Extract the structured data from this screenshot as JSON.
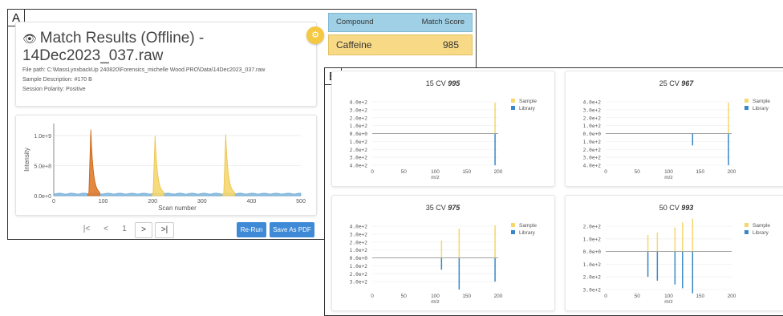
{
  "panel_a_letter": "A",
  "panel_b_letter": "B",
  "header": {
    "title_line1": "Match Results (Offline) -",
    "title_line2": "14Dec2023_037.raw",
    "file_path": "File path: C:\\MassLynxbackUp 240820\\Forensics_michelle Wood.PRO\\Data\\14Dec2023_037.raw",
    "sample_description": "Sample Description: #170 B",
    "session_polarity": "Session Polarity: Positive"
  },
  "icons": {
    "eye": "eye-icon",
    "gear": "gear-icon"
  },
  "colors": {
    "sample": "#f5d76e",
    "library": "#3a87c8",
    "peak_highlight": "#e07b2a",
    "button_blue": "#3f8ad6",
    "table_head": "#9fd0e6",
    "table_row": "#f8da86"
  },
  "chromatogram": {
    "type": "area",
    "ylabel": "Intensity",
    "xlabel": "Scan number",
    "y_ticks": [
      "1.0e+9",
      "5.0e+8",
      "0.0e+0"
    ],
    "x_ticks": [
      "0",
      "100",
      "200",
      "300",
      "400",
      "500"
    ],
    "xlim": [
      0,
      500
    ],
    "ylim": [
      0,
      1200000000
    ],
    "peaks": [
      {
        "apex": 75,
        "height": 1100000000,
        "highlight": true
      },
      {
        "apex": 205,
        "height": 1000000000,
        "highlight": false
      },
      {
        "apex": 348,
        "height": 1020000000,
        "highlight": false
      }
    ],
    "baseline": 30000000
  },
  "pager": {
    "first": "|<",
    "prev": "<",
    "page": "1",
    "next": ">",
    "last": ">|"
  },
  "buttons": {
    "rerun": "Re-Run",
    "save_pdf": "Save As PDF"
  },
  "score_table": {
    "col_compound": "Compound",
    "col_score": "Match Score",
    "rows": [
      {
        "compound": "Caffeine",
        "score": "985"
      }
    ]
  },
  "chart_data": [
    {
      "type": "bar",
      "title_cv": "15 CV",
      "title_score": "995",
      "legend": [
        "Sample",
        "Library"
      ],
      "xlabel": "m/z",
      "xlim": [
        0,
        200
      ],
      "x_ticks": [
        "0",
        "50",
        "100",
        "150",
        "200"
      ],
      "y_ticks": [
        "4.0e+2",
        "3.0e+2",
        "2.0e+2",
        "1.0e+2",
        "0.0e+0",
        "1.0e+2",
        "2.0e+2",
        "3.0e+2",
        "4.0e+2"
      ],
      "ylim": [
        -400,
        400
      ],
      "series": [
        {
          "name": "Sample",
          "x": [
            195
          ],
          "values": [
            390
          ]
        },
        {
          "name": "Library",
          "x": [
            195
          ],
          "values": [
            -400
          ]
        }
      ]
    },
    {
      "type": "bar",
      "title_cv": "25 CV",
      "title_score": "967",
      "legend": [
        "Sample",
        "Library"
      ],
      "xlabel": "m/z",
      "xlim": [
        0,
        200
      ],
      "x_ticks": [
        "0",
        "50",
        "100",
        "150",
        "200"
      ],
      "y_ticks": [
        "4.0e+2",
        "3.0e+2",
        "2.0e+2",
        "1.0e+2",
        "0.0e+0",
        "1.0e+2",
        "2.0e+2",
        "3.0e+2",
        "4.0e+2"
      ],
      "ylim": [
        -400,
        400
      ],
      "series": [
        {
          "name": "Sample",
          "x": [
            195
          ],
          "values": [
            390
          ]
        },
        {
          "name": "Library",
          "x": [
            138,
            195
          ],
          "values": [
            -150,
            -400
          ]
        }
      ]
    },
    {
      "type": "bar",
      "title_cv": "35 CV",
      "title_score": "975",
      "legend": [
        "Sample",
        "Library"
      ],
      "xlabel": "m/z",
      "xlim": [
        0,
        200
      ],
      "x_ticks": [
        "0",
        "50",
        "100",
        "150",
        "200"
      ],
      "y_ticks": [
        "4.0e+2",
        "3.0e+2",
        "2.0e+2",
        "1.0e+2",
        "0.0e+0",
        "1.0e+2",
        "2.0e+2",
        "3.0e+2"
      ],
      "ylim": [
        -400,
        400
      ],
      "series": [
        {
          "name": "Sample",
          "x": [
            110,
            138,
            195
          ],
          "values": [
            220,
            370,
            410
          ]
        },
        {
          "name": "Library",
          "x": [
            110,
            138,
            195
          ],
          "values": [
            -150,
            -400,
            -300
          ]
        }
      ]
    },
    {
      "type": "bar",
      "title_cv": "50 CV",
      "title_score": "993",
      "legend": [
        "Sample",
        "Library"
      ],
      "xlabel": "m/z",
      "xlim": [
        0,
        200
      ],
      "x_ticks": [
        "0",
        "50",
        "100",
        "150",
        "200"
      ],
      "y_ticks": [
        "2.0e+2",
        "1.0e+2",
        "0.0e+0",
        "1.0e+2",
        "2.0e+2",
        "3.0e+2"
      ],
      "ylim": [
        -300,
        200
      ],
      "series": [
        {
          "name": "Sample",
          "x": [
            67,
            82,
            110,
            122,
            138
          ],
          "values": [
            130,
            150,
            190,
            230,
            260
          ]
        },
        {
          "name": "Library",
          "x": [
            67,
            82,
            110,
            122,
            138
          ],
          "values": [
            -200,
            -230,
            -260,
            -290,
            -330
          ]
        }
      ]
    }
  ]
}
